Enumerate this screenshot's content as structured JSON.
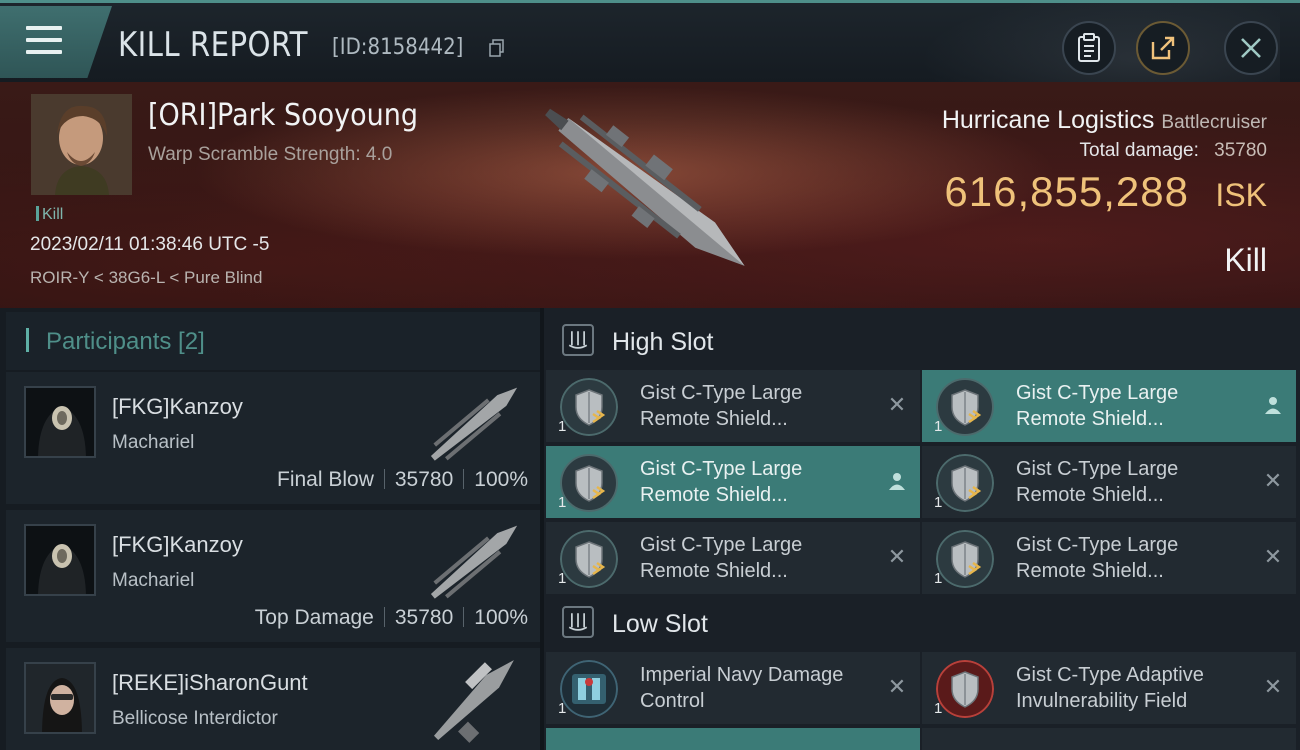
{
  "header": {
    "menu_icon": "hamburger-menu-icon",
    "title": "KILL REPORT",
    "report_id": "[ID:8158442]",
    "copy_icon": "copy-icon",
    "buttons": [
      {
        "name": "clipboard-icon"
      },
      {
        "name": "share-icon"
      },
      {
        "name": "close-icon"
      }
    ]
  },
  "victim": {
    "pilot": "[ORI]Park Sooyoung",
    "scramble": "Warp Scramble Strength: 4.0",
    "tag": "Kill",
    "datetime": "2023/02/11 01:38:46 UTC -5",
    "location": "ROIR-Y < 38G6-L < Pure Blind",
    "ship_name": "Hurricane Logistics",
    "ship_class": "Battlecruiser",
    "total_damage_label": "Total damage:",
    "total_damage": "35780",
    "isk_value": "616,855,288",
    "isk_unit": "ISK",
    "result": "Kill"
  },
  "participants": {
    "title": "Participants [2]",
    "rows": [
      {
        "name": "[FKG]Kanzoy",
        "ship": "Machariel",
        "role": "Final Blow",
        "damage": "35780",
        "percent": "100%"
      },
      {
        "name": "[FKG]Kanzoy",
        "ship": "Machariel",
        "role": "Top Damage",
        "damage": "35780",
        "percent": "100%"
      },
      {
        "name": "[REKE]iSharonGunt",
        "ship": "Bellicose Interdictor"
      }
    ]
  },
  "fitting": {
    "high_title": "High Slot",
    "low_title": "Low Slot",
    "high": [
      {
        "name": "Gist C-Type Large Remote Shield...",
        "qty": "1",
        "state": "destroyed"
      },
      {
        "name": "Gist C-Type Large Remote Shield...",
        "qty": "1",
        "state": "dropped"
      },
      {
        "name": "Gist C-Type Large Remote Shield...",
        "qty": "1",
        "state": "dropped"
      },
      {
        "name": "Gist C-Type Large Remote Shield...",
        "qty": "1",
        "state": "destroyed"
      },
      {
        "name": "Gist C-Type Large Remote Shield...",
        "qty": "1",
        "state": "destroyed"
      },
      {
        "name": "Gist C-Type Large Remote Shield...",
        "qty": "1",
        "state": "destroyed"
      }
    ],
    "low": [
      {
        "name": "Imperial Navy Damage Control",
        "qty": "1",
        "state": "destroyed"
      },
      {
        "name": "Gist C-Type Adaptive Invulnerability Field",
        "qty": "1",
        "state": "destroyed"
      }
    ]
  },
  "colors": {
    "accent_teal": "#3b7b77",
    "isk_gold": "#efc27a",
    "background": "#11161b"
  }
}
